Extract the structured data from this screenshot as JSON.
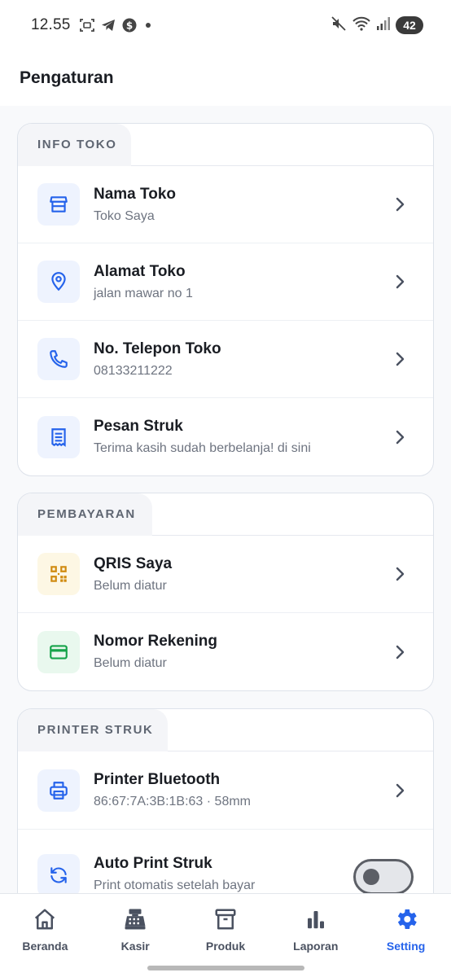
{
  "status_bar": {
    "time": "12.55",
    "battery": "42"
  },
  "header": {
    "title": "Pengaturan"
  },
  "sections": {
    "info_toko": {
      "label": "INFO TOKO",
      "items": [
        {
          "title": "Nama Toko",
          "subtitle": "Toko Saya",
          "icon": "store-icon"
        },
        {
          "title": "Alamat Toko",
          "subtitle": "jalan mawar no 1",
          "icon": "location-pin-icon"
        },
        {
          "title": "No. Telepon Toko",
          "subtitle": "08133211222",
          "icon": "phone-icon"
        },
        {
          "title": "Pesan Struk",
          "subtitle": "Terima kasih sudah berbelanja! di sini",
          "icon": "receipt-icon"
        }
      ]
    },
    "pembayaran": {
      "label": "PEMBAYARAN",
      "items": [
        {
          "title": "QRIS Saya",
          "subtitle": "Belum diatur",
          "icon": "qr-code-icon"
        },
        {
          "title": "Nomor Rekening",
          "subtitle": "Belum diatur",
          "icon": "credit-card-icon"
        }
      ]
    },
    "printer": {
      "label": "PRINTER STRUK",
      "items": [
        {
          "title": "Printer Bluetooth",
          "subtitle": "86:67:7A:3B:1B:63 · 58mm",
          "icon": "printer-icon"
        },
        {
          "title": "Auto Print Struk",
          "subtitle": "Print otomatis setelah bayar",
          "icon": "refresh-icon",
          "toggle_on": false
        }
      ]
    }
  },
  "bottom_nav": {
    "items": [
      {
        "label": "Beranda",
        "icon": "home-icon",
        "active": false
      },
      {
        "label": "Kasir",
        "icon": "cash-register-icon",
        "active": false
      },
      {
        "label": "Produk",
        "icon": "archive-box-icon",
        "active": false
      },
      {
        "label": "Laporan",
        "icon": "bar-chart-icon",
        "active": false
      },
      {
        "label": "Setting",
        "icon": "gear-icon",
        "active": true
      }
    ]
  },
  "colors": {
    "accent": "#2563eb",
    "icon_blue": "#2563eb",
    "icon_amber": "#d08a0e",
    "icon_green": "#16a34a"
  }
}
